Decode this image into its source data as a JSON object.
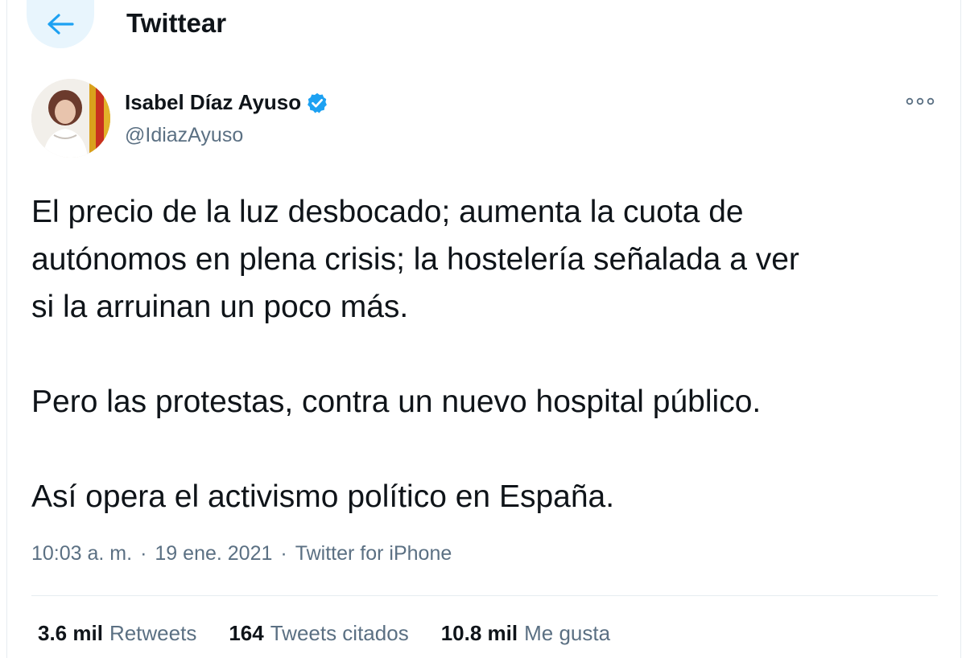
{
  "header": {
    "title": "Twittear",
    "back_icon": "arrow-left-icon",
    "accent_color": "#1da1f2"
  },
  "tweet": {
    "author": {
      "display_name": "Isabel Díaz Ayuso",
      "handle": "@IdiazAyuso",
      "verified": true
    },
    "text": {
      "line1": "El precio de la luz desbocado; aumenta la cuota de",
      "line2": "autónomos en plena crisis; la hostelería señalada a ver",
      "line3": "si la arruinan un poco más.",
      "line4": "Pero las protestas, contra un nuevo hospital público.",
      "line5": "Así opera el activismo político en España."
    },
    "meta": {
      "time": "10:03 a. m.",
      "separator": "·",
      "date": "19 ene. 2021",
      "source": "Twitter for iPhone"
    },
    "stats": {
      "retweets_count": "3.6 mil",
      "retweets_label": "Retweets",
      "quotes_count": "164",
      "quotes_label": "Tweets citados",
      "likes_count": "10.8 mil",
      "likes_label": "Me gusta"
    }
  },
  "colors": {
    "text_primary": "#0f1419",
    "text_secondary": "#5b7083",
    "border": "#e6ecf0",
    "verified_badge": "#1da1f2"
  }
}
